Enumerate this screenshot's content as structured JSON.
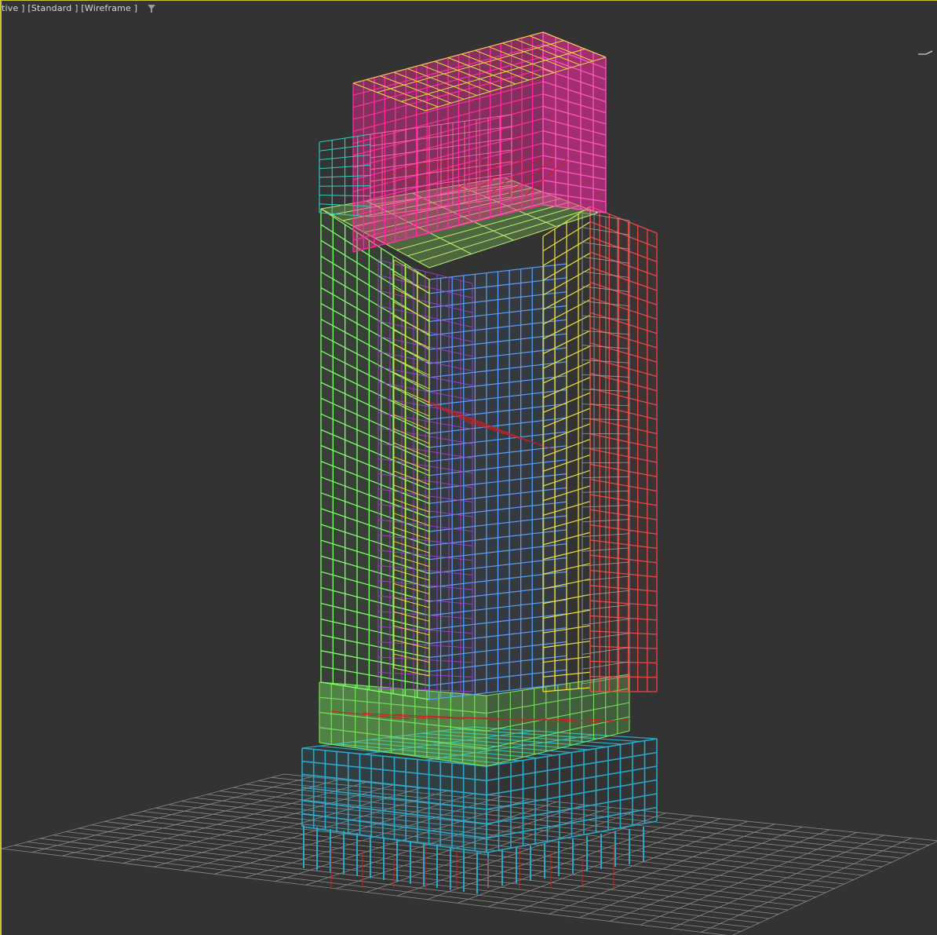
{
  "viewport": {
    "labels": {
      "view": "tive ]",
      "shading": "[Standard ]",
      "mode": "[Wireframe ]"
    },
    "icons": {
      "filter": "filter-icon",
      "nav_gizmo": "viewcube-icon"
    },
    "colors": {
      "background": "#333333",
      "border": "#c8c832",
      "grid": "#8a8a8a"
    }
  },
  "model": {
    "colors": {
      "top_crown": "#ff2aa0",
      "upper_left": "#7dff6a",
      "upper_right": "#e84848",
      "upper_core": "#5aa0ff",
      "mid_band": "#74e05a",
      "podium": "#2aa8c8",
      "accent_yellow": "#f0e040",
      "accent_red": "#cc2020"
    }
  }
}
